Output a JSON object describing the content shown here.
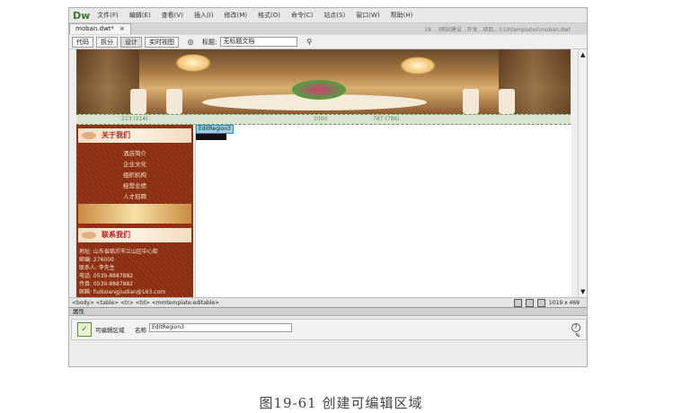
{
  "app": {
    "logo": "Dw"
  },
  "menu": [
    "文件(F)",
    "编辑(E)",
    "查看(V)",
    "插入(I)",
    "修改(M)",
    "格式(O)",
    "命令(C)",
    "站点(S)",
    "窗口(W)",
    "帮助(H)"
  ],
  "document": {
    "tab": "moban.dwt*",
    "close": "×",
    "path": "19 ...(网站建设...开发...项目...)\\19\\templates\\moban.dwt"
  },
  "toolbar": {
    "code": "代码",
    "split": "拆分",
    "design": "设计",
    "live_view": "实时视图",
    "title_label": "标题:",
    "title_value": "无标题文档"
  },
  "layout": {
    "width_label": "1000",
    "left_width": "213 (214)",
    "right_width": "787 (786)"
  },
  "sidebar": {
    "about_title": "关于我们",
    "links": [
      "酒店简介",
      "企业文化",
      "组织机构",
      "经营业绩",
      "人才招聘"
    ],
    "contact_title": "联系我们",
    "contact_lines": [
      "地址: 山东省临沂市兰山区中心街",
      "邮编: 276000",
      "联系人: 李先生",
      "电话: 0539-8887882",
      "传真: 0539-8887882",
      "邮箱: fudixiangjiudian@163.com"
    ]
  },
  "editable_region": {
    "tag": "EditRegion3"
  },
  "statusbar": {
    "tags": "<body> <table> <tr> <td> <mmtemplate:editable>",
    "size": "1019 x 469"
  },
  "properties": {
    "title": "属性",
    "type": "可编辑区域",
    "name_label": "名称",
    "name_value": "EditRegion3",
    "help": "?",
    "edit": "✎"
  },
  "caption": "图19-61 创建可编辑区域"
}
